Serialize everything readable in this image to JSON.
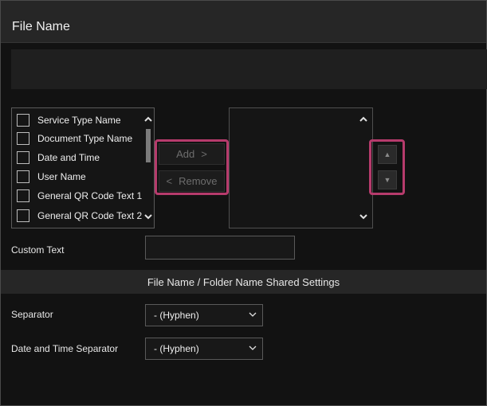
{
  "header": {
    "title": "File Name"
  },
  "list": {
    "items": [
      {
        "label": "Service Type Name"
      },
      {
        "label": "Document Type Name"
      },
      {
        "label": "Date and Time"
      },
      {
        "label": "User Name"
      },
      {
        "label": "General QR Code Text 1"
      },
      {
        "label": "General QR Code Text 2"
      }
    ]
  },
  "actions": {
    "add_label": "Add",
    "add_glyph": ">",
    "remove_label": "Remove",
    "remove_glyph": "<"
  },
  "order": {
    "up_glyph": "▲",
    "down_glyph": "▼"
  },
  "custom_text": {
    "label": "Custom Text",
    "value": ""
  },
  "shared_settings": {
    "title": "File Name / Folder Name Shared Settings"
  },
  "separator": {
    "label": "Separator",
    "value": "- (Hyphen)"
  },
  "date_time_separator": {
    "label": "Date and Time Separator",
    "value": "- (Hyphen)"
  },
  "colors": {
    "highlight": "#b63b6c",
    "background": "#121212",
    "panel": "#262626"
  }
}
